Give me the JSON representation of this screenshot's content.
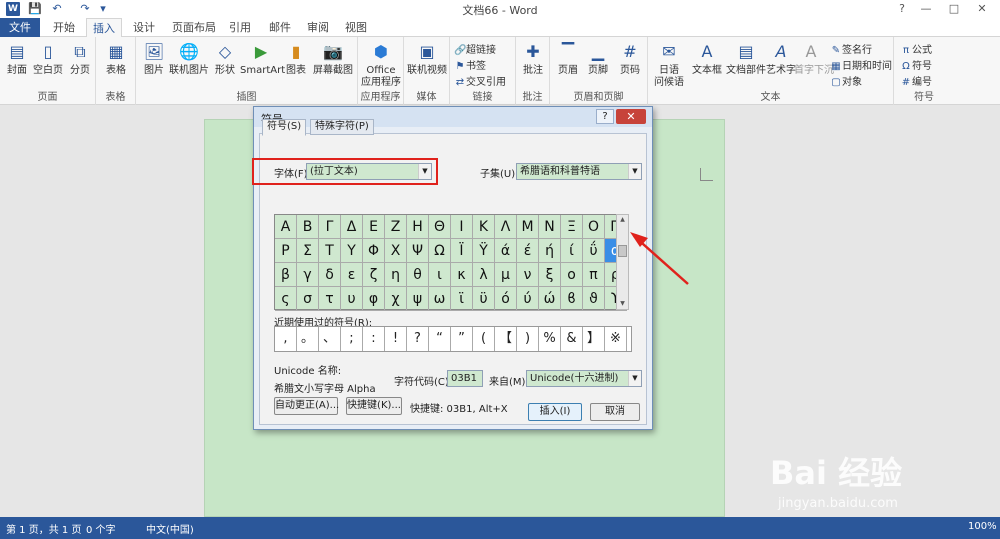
{
  "window": {
    "title": "文档66 - Word",
    "controls": {
      "help": "?",
      "minimize": "—",
      "maximize": "□",
      "close": "✕"
    }
  },
  "quick_access": {
    "word_logo": "W",
    "save": "💾",
    "undo": "↶",
    "redo": "↷",
    "customize": "▾"
  },
  "tabs": [
    {
      "label": "文件"
    },
    {
      "label": "开始"
    },
    {
      "label": "插入"
    },
    {
      "label": "设计"
    },
    {
      "label": "页面布局"
    },
    {
      "label": "引用"
    },
    {
      "label": "邮件"
    },
    {
      "label": "审阅"
    },
    {
      "label": "视图"
    }
  ],
  "ribbon": {
    "groups": {
      "pages": "页面",
      "tables": "表格",
      "illustrations": "插图",
      "apps": "应用程序",
      "media": "媒体",
      "links": "链接",
      "comments": "批注",
      "header_footer": "页眉和页脚",
      "text": "文本",
      "symbols": "符号"
    },
    "buttons": {
      "cover": "封面",
      "blank_page": "空白页",
      "page_break": "分页",
      "table": "表格",
      "pictures": "图片",
      "online_pictures": "联机图片",
      "shapes": "形状",
      "smartart": "SmartArt",
      "chart": "图表",
      "screenshot": "屏幕截图",
      "office_apps": "Office",
      "office_apps_2": "应用程序",
      "online_video": "联机视频",
      "hyperlink": "超链接",
      "bookmark": "书签",
      "cross_ref": "交叉引用",
      "comment": "批注",
      "header": "页眉",
      "footer": "页脚",
      "page_number": "页码",
      "japanese_greetings": "日语",
      "japanese_greetings_2": "问候语",
      "text_box": "文本框",
      "quick_parts": "文档部件",
      "wordart": "艺术字",
      "drop_cap": "首字下沉",
      "signature_line": "签名行",
      "date_time": "日期和时间",
      "object": "对象",
      "equation": "公式",
      "symbol": "符号",
      "numbering": "编号"
    }
  },
  "dialog": {
    "title": "符号",
    "help": "?",
    "close": "✕",
    "tabs": [
      "符号(S)",
      "特殊字符(P)"
    ],
    "font_label": "字体(F):",
    "font_value": "(拉丁文本)",
    "subset_label": "子集(U):",
    "subset_value": "希腊语和科普特语",
    "symbols": [
      [
        "Α",
        "Β",
        "Γ",
        "Δ",
        "Ε",
        "Ζ",
        "Η",
        "Θ",
        "Ι",
        "Κ",
        "Λ",
        "Μ",
        "Ν",
        "Ξ",
        "Ο",
        "Π"
      ],
      [
        "Ρ",
        "Σ",
        "Τ",
        "Υ",
        "Φ",
        "Χ",
        "Ψ",
        "Ω",
        "Ϊ",
        "Ϋ",
        "ά",
        "έ",
        "ή",
        "ί",
        "ΰ",
        "α"
      ],
      [
        "β",
        "γ",
        "δ",
        "ε",
        "ζ",
        "η",
        "θ",
        "ι",
        "κ",
        "λ",
        "μ",
        "ν",
        "ξ",
        "ο",
        "π",
        "ρ"
      ],
      [
        "ς",
        "σ",
        "τ",
        "υ",
        "φ",
        "χ",
        "ψ",
        "ω",
        "ϊ",
        "ϋ",
        "ό",
        "ύ",
        "ώ",
        "ϐ",
        "ϑ",
        "ϒ"
      ]
    ],
    "selected_symbol": "α",
    "recent_label": "近期使用过的符号(R):",
    "recent": [
      ",",
      "。",
      "、",
      ";",
      ":",
      "!",
      "?",
      "“",
      "”",
      "(",
      "【",
      ")",
      "%",
      "&",
      "】",
      "※"
    ],
    "unicode_name_label": "Unicode 名称:",
    "unicode_name_value": "希腊文小写字母 Alpha",
    "char_code_label": "字符代码(C):",
    "char_code_value": "03B1",
    "from_label": "来自(M):",
    "from_value": "Unicode(十六进制)",
    "autocorrect_button": "自动更正(A)...",
    "shortcut_key_button": "快捷键(K)...",
    "shortcut_key_text": "快捷键: 03B1, Alt+X",
    "insert_button": "插入(I)",
    "cancel_button": "取消"
  },
  "status": {
    "page": "第 1 页，共 1 页",
    "words": "0 个字",
    "language": "中文(中国)",
    "zoom": "100%"
  },
  "watermark": {
    "brand": "Bai  经验",
    "url": "jingyan.baidu.com"
  }
}
